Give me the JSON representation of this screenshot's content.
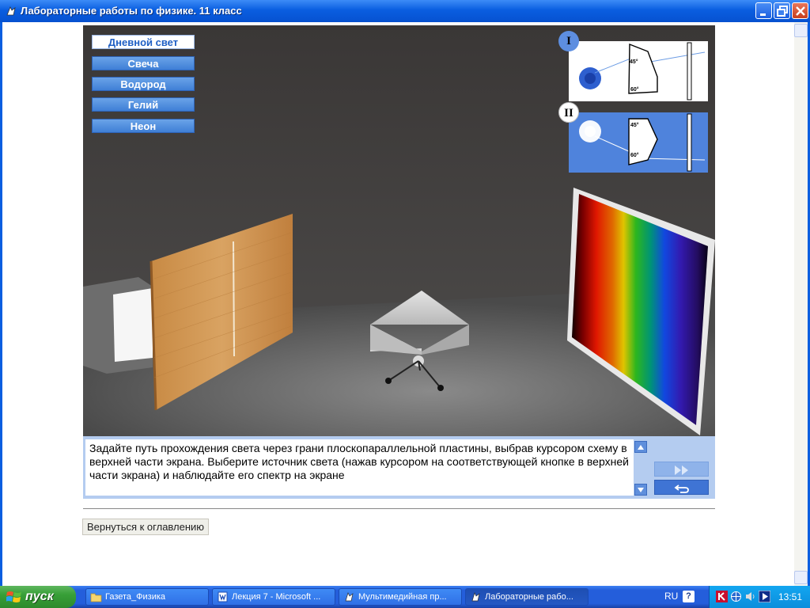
{
  "window": {
    "title": "Лабораторные работы по физике. 11 класс"
  },
  "sources": {
    "items": [
      {
        "label": "Дневной свет",
        "active": true
      },
      {
        "label": "Свеча",
        "active": false
      },
      {
        "label": "Водород",
        "active": false
      },
      {
        "label": "Гелий",
        "active": false
      },
      {
        "label": "Неон",
        "active": false
      }
    ]
  },
  "schemas": [
    {
      "badge": "I",
      "angle_top": "45°",
      "angle_bottom": "60°"
    },
    {
      "badge": "II",
      "angle_top": "45°",
      "angle_bottom": "60°"
    }
  ],
  "instruction": {
    "text": "Задайте путь прохождения света через грани плоскопараллельной пластины, выбрав курсором схему в верхней части экрана. Выберите источник света (нажав курсором на соответствующей кнопке в верхней части экрана) и наблюдайте его спектр на экране"
  },
  "back": {
    "label": "Вернуться к оглавлению"
  },
  "taskbar": {
    "start_label": "пуск",
    "tasks": [
      {
        "label": "Газета_Физика",
        "icon": "folder-icon"
      },
      {
        "label": "Лекция 7 - Microsoft ...",
        "icon": "word-icon"
      },
      {
        "label": "Мультимедийная пр...",
        "icon": "app-icon"
      },
      {
        "label": "Лабораторные рабо...",
        "icon": "app-icon"
      }
    ],
    "lang": "RU",
    "clock": "13:51"
  },
  "colors": {
    "titlebar": "#0a5ee0",
    "panel": "#b4ccf0",
    "accent": "#3f7fd6"
  }
}
